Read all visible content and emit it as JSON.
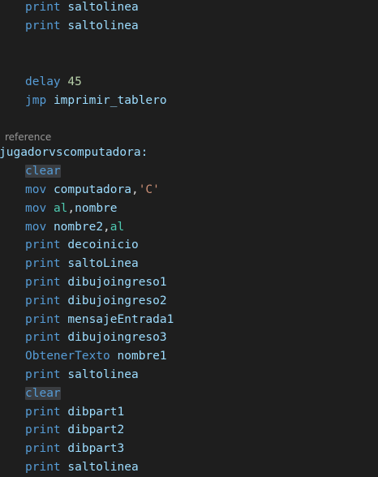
{
  "editor": {
    "codelens": "reference",
    "lines": [
      {
        "kw": "print",
        "arg": "saltolinea"
      },
      {
        "kw": "print",
        "arg": "saltolinea"
      },
      {
        "kw": "delay",
        "num": "45"
      },
      {
        "kw": "jmp",
        "arg": "imprimir_tablero"
      },
      {
        "label": "jugadorvscomputadora:"
      },
      {
        "kw": "clear"
      },
      {
        "kw": "mov",
        "a": "computadora",
        "sep": ",",
        "str": "'C'"
      },
      {
        "kw": "mov",
        "reg": "al",
        "sep": ",",
        "b": "nombre"
      },
      {
        "kw": "mov",
        "a": "nombre2",
        "sep": ",",
        "reg": "al"
      },
      {
        "kw": "print",
        "arg": "decoinicio"
      },
      {
        "kw": "print",
        "arg": "saltoLinea"
      },
      {
        "kw": "print",
        "arg": "dibujoingreso1"
      },
      {
        "kw": "print",
        "arg": "dibujoingreso2"
      },
      {
        "kw": "print",
        "arg": "mensajeEntrada1"
      },
      {
        "kw": "print",
        "arg": "dibujoingreso3"
      },
      {
        "macro": "ObtenerTexto",
        "arg": "nombre1"
      },
      {
        "kw": "print",
        "arg": "saltolinea"
      },
      {
        "kw": "clear"
      },
      {
        "kw": "print",
        "arg": "dibpart1"
      },
      {
        "kw": "print",
        "arg": "dibpart2"
      },
      {
        "kw": "print",
        "arg": "dibpart3"
      },
      {
        "kw": "print",
        "arg": "saltolinea"
      }
    ]
  },
  "colors": {
    "background": "#1e1e1e",
    "keyword": "#569cd6",
    "identifier": "#9cdcfe",
    "register": "#4ec9b0",
    "number": "#b5cea8",
    "string": "#ce9178",
    "text": "#d4d4d4",
    "selection_highlight": "#3a3d41",
    "codelens": "#999999"
  }
}
